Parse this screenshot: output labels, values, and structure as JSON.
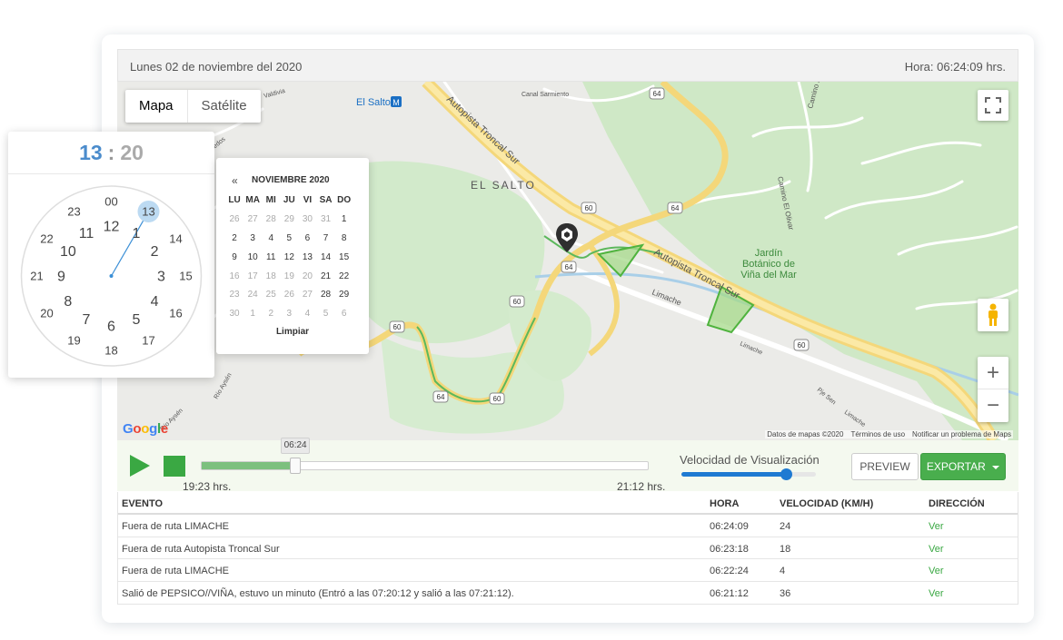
{
  "header": {
    "date": "Lunes 02 de noviembre del 2020",
    "time": "Hora: 06:24:09 hrs."
  },
  "map": {
    "type_buttons": [
      "Mapa",
      "Satélite"
    ],
    "labels": {
      "el_salto": "EL SALTO",
      "el_salto_station": "El Salto",
      "metro": "M",
      "canal": "Canal Sarmiento",
      "autopista_1": "Autopista Troncal Sur",
      "autopista_2": "Autopista Troncal Sur",
      "limache_1": "Limache",
      "limache_2": "Limache",
      "limache_3": "Limache",
      "jardin": [
        "Jardín",
        "Botánico de",
        "Viña del Mar"
      ],
      "camino_olivar": "Camino El Olivar",
      "camino": "Camino El",
      "valdivia": "Valdivia",
      "vinedos": "Viñedos",
      "rio_aysen_1": "Río Aysén",
      "rio_aysen_2": "Río Aysén",
      "pje_sen": "Pje Sen"
    },
    "route_shields": [
      "64",
      "60",
      "64",
      "64",
      "60",
      "60",
      "64",
      "60",
      "60"
    ],
    "attribution": [
      "Datos de mapas ©2020",
      "Términos de uso",
      "Notificar un problema de Maps"
    ],
    "logo": "Google",
    "zoom_in": "+",
    "zoom_out": "−",
    "icons": {
      "fullscreen": "fullscreen-icon",
      "pegman": "pegman-icon",
      "marker": "vehicle-marker-icon"
    }
  },
  "playback": {
    "current": "06:24",
    "start": "19:23 hrs.",
    "end": "21:12 hrs.",
    "progress": 0.21,
    "speed_label": "Velocidad de Visualización",
    "speed_value": 0.78,
    "preview": "PREVIEW",
    "export": "EXPORTAR",
    "colors": {
      "green": "#3aa843",
      "blue": "#1e7ad2"
    }
  },
  "events_table": {
    "columns": [
      "EVENTO",
      "HORA",
      "VELOCIDAD (KM/H)",
      "DIRECCIÓN"
    ],
    "rows": [
      {
        "evento": "Fuera de ruta LIMACHE",
        "hora": "06:24:09",
        "velocidad": "24",
        "direccion": "Ver"
      },
      {
        "evento": "Fuera de ruta Autopista Troncal Sur",
        "hora": "06:23:18",
        "velocidad": "18",
        "direccion": "Ver"
      },
      {
        "evento": "Fuera de ruta LIMACHE",
        "hora": "06:22:24",
        "velocidad": "4",
        "direccion": "Ver"
      },
      {
        "evento": "Salió de PEPSICO//VIÑA, estuvo un minuto (Entró a las 07:20:12 y salió a las 07:21:12).",
        "hora": "06:21:12",
        "velocidad": "36",
        "direccion": "Ver"
      }
    ]
  },
  "clock": {
    "hour": "13",
    "separator": ":",
    "minute": "20",
    "outer": [
      "00",
      "13",
      "14",
      "15",
      "16",
      "17",
      "18",
      "19",
      "20",
      "21",
      "22",
      "23"
    ],
    "inner": [
      "12",
      "1",
      "2",
      "3",
      "4",
      "5",
      "6",
      "7",
      "8",
      "9",
      "10",
      "11"
    ],
    "selected": "13"
  },
  "calendar": {
    "nav_prev": "«",
    "title": "NOVIEMBRE 2020",
    "weekdays": [
      "LU",
      "MA",
      "MI",
      "JU",
      "VI",
      "SA",
      "DO"
    ],
    "weeks": [
      [
        "26",
        "27",
        "28",
        "29",
        "30",
        "31",
        "1"
      ],
      [
        "2",
        "3",
        "4",
        "5",
        "6",
        "7",
        "8"
      ],
      [
        "9",
        "10",
        "11",
        "12",
        "13",
        "14",
        "15"
      ],
      [
        "16",
        "17",
        "18",
        "19",
        "20",
        "21",
        "22"
      ],
      [
        "23",
        "24",
        "25",
        "26",
        "27",
        "28",
        "29"
      ],
      [
        "30",
        "1",
        "2",
        "3",
        "4",
        "5",
        "6"
      ]
    ],
    "clear": "Limpiar"
  }
}
